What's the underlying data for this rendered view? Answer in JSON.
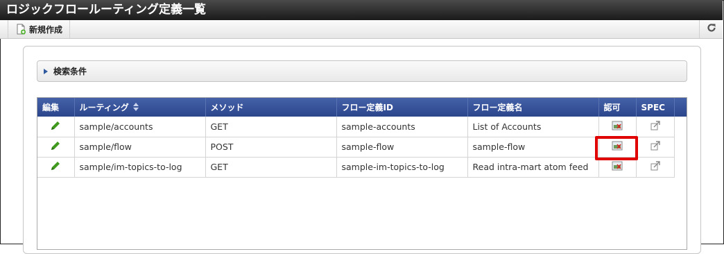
{
  "window": {
    "title": "ロジックフロールーティング定義一覧"
  },
  "toolbar": {
    "new_label": "新規作成"
  },
  "search": {
    "label": "検索条件"
  },
  "grid": {
    "columns": {
      "edit": "編集",
      "routing": "ルーティング",
      "method": "メソッド",
      "flow_id": "フロー定義ID",
      "flow_name": "フロー定義名",
      "auth": "認可",
      "spec": "SPEC"
    },
    "rows": [
      {
        "routing": "sample/accounts",
        "method": "GET",
        "flow_id": "sample-accounts",
        "flow_name": "List of Accounts"
      },
      {
        "routing": "sample/flow",
        "method": "POST",
        "flow_id": "sample-flow",
        "flow_name": "sample-flow"
      },
      {
        "routing": "sample/im-topics-to-log",
        "method": "GET",
        "flow_id": "sample-im-topics-to-log",
        "flow_name": "Read intra-mart atom feed"
      }
    ]
  },
  "icons": {
    "new": "new-document-icon",
    "refresh": "refresh-icon",
    "expand": "triangle-right-icon",
    "sort": "sort-updown-icon",
    "edit": "pencil-icon",
    "auth": "authorization-icon",
    "spec": "external-link-icon"
  },
  "colors": {
    "header_blue": "#2c468c",
    "highlight_red": "#e00000",
    "pencil_green": "#3f9a1e"
  }
}
